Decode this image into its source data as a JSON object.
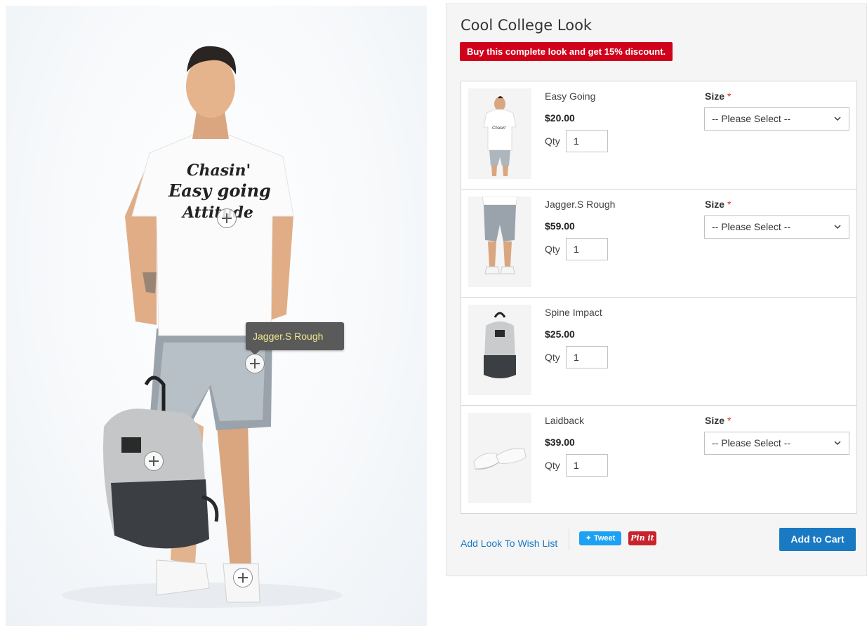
{
  "hero": {
    "tooltip": "Jagger.S Rough",
    "shirt_text": [
      "Chasin'",
      "Easy going",
      "Attitude"
    ],
    "hotspots": [
      "tshirt",
      "shorts",
      "backpack",
      "sneakers"
    ]
  },
  "look": {
    "title": "Cool College Look",
    "discount": "Buy this complete look and get 15% discount."
  },
  "items": [
    {
      "name": "Easy Going",
      "price": "$20.00",
      "qty_label": "Qty",
      "qty": "1",
      "size_label": "Size",
      "required": "*",
      "size_value": "-- Please Select --"
    },
    {
      "name": "Jagger.S Rough",
      "price": "$59.00",
      "qty_label": "Qty",
      "qty": "1",
      "size_label": "Size",
      "required": "*",
      "size_value": "-- Please Select --"
    },
    {
      "name": "Spine Impact",
      "price": "$25.00",
      "qty_label": "Qty",
      "qty": "1"
    },
    {
      "name": "Laidback",
      "price": "$39.00",
      "qty_label": "Qty",
      "qty": "1",
      "size_label": "Size",
      "required": "*",
      "size_value": "-- Please Select --"
    }
  ],
  "footer": {
    "wishlist": "Add Look To Wish List",
    "tweet": "Tweet",
    "pin": "Pin it",
    "add_to_cart": "Add to Cart"
  },
  "colors": {
    "accent": "#1979c3",
    "badge": "#d0021b",
    "required": "#e02b27"
  }
}
